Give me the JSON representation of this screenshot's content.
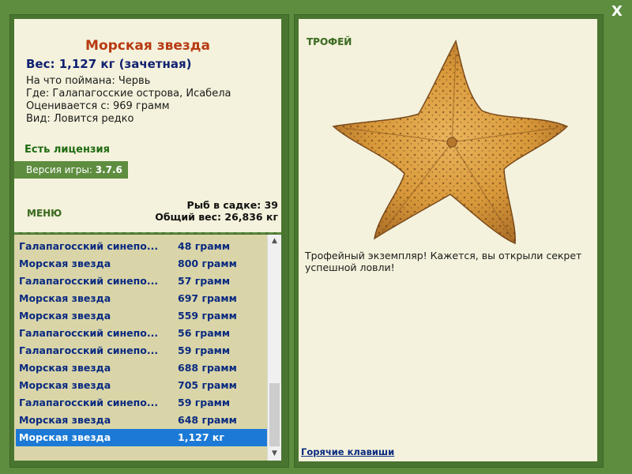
{
  "window": {
    "close_label": "X"
  },
  "fish": {
    "title": "Морская звезда",
    "weight": "Вес: 1,127 кг (зачетная)",
    "details": [
      "На что поймана: Червь",
      "Где: Галапагосские острова, Исабела",
      "Оценивается с: 969 грамм",
      "Вид: Ловится редко"
    ]
  },
  "license": "Есть лицензия",
  "version": {
    "label": "Версия игры:",
    "value": "3.7.6"
  },
  "menu_label": "МЕНЮ",
  "stats": {
    "fish_count": "Рыб в садке: 39",
    "total_weight": "Общий вес: 26,836 кг"
  },
  "catch_list": [
    {
      "name": "Галапагосский синепо...",
      "weight": "48 грамм"
    },
    {
      "name": "Морская звезда",
      "weight": "800 грамм"
    },
    {
      "name": "Галапагосский синепо...",
      "weight": "57 грамм"
    },
    {
      "name": "Морская звезда",
      "weight": "697 грамм"
    },
    {
      "name": "Морская звезда",
      "weight": "559 грамм"
    },
    {
      "name": "Галапагосский синепо...",
      "weight": "56 грамм"
    },
    {
      "name": "Галапагосский синепо...",
      "weight": "59 грамм"
    },
    {
      "name": "Морская звезда",
      "weight": "688 грамм"
    },
    {
      "name": "Морская звезда",
      "weight": "705 грамм"
    },
    {
      "name": "Галапагосский синепо...",
      "weight": "59 грамм"
    },
    {
      "name": "Морская звезда",
      "weight": "648 грамм"
    },
    {
      "name": "Морская звезда",
      "weight": "1,127 кг"
    }
  ],
  "selected_index": 11,
  "trophy": {
    "label": "ТРОФЕЙ",
    "text": "Трофейный экземпляр! Кажется, вы открыли секрет успешной ловли!"
  },
  "hotkeys_label": "Горячие клавиши",
  "colors": {
    "frame": "#5e8d40",
    "panel": "#f4f2dc",
    "list_bg": "#d9d5a8",
    "title": "#b83a12",
    "list_text": "#0a2a80",
    "selected": "#1c7ad6",
    "license": "#1f6b12"
  }
}
